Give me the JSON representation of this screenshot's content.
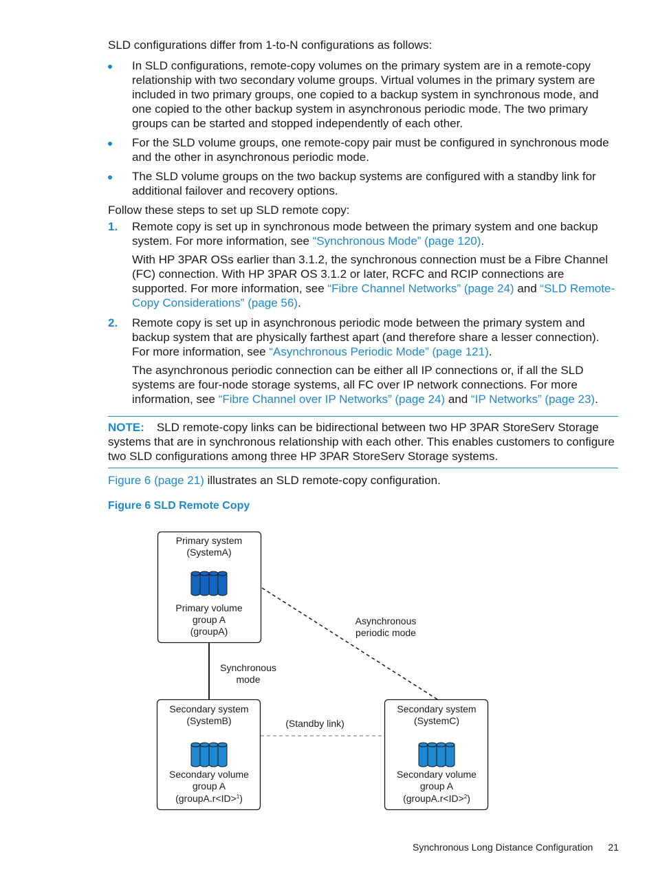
{
  "intro": "SLD configurations differ from 1-to-N configurations as follows:",
  "bullets": [
    "In SLD configurations, remote-copy volumes on the primary system are in a remote-copy relationship with two secondary volume groups. Virtual volumes in the primary system are included in two primary groups, one copied to a backup system in synchronous mode, and one copied to the other backup system in asynchronous periodic mode. The two primary groups can be started and stopped independently of each other.",
    "For the SLD volume groups, one remote-copy pair must be configured in synchronous mode and the other in asynchronous periodic mode.",
    "The SLD volume groups on the two backup systems are configured with a standby link for additional failover and recovery options."
  ],
  "steps_intro": "Follow these steps to set up SLD remote copy:",
  "steps": [
    {
      "number": "1.",
      "p1_text": "Remote copy is set up in synchronous mode between the primary system and one backup system. For more information, see ",
      "p1_link": "“Synchronous Mode” (page 120)",
      "p1_end": ".",
      "p2_text": "With HP 3PAR OSs earlier than 3.1.2, the synchronous connection must be a Fibre Channel (FC) connection. With HP 3PAR OS 3.1.2 or later, RCFC and RCIP connections are supported. For more information, see ",
      "p2_link1": "“Fibre Channel Networks” (page 24)",
      "p2_mid": " and ",
      "p2_link2": "“SLD Remote-Copy Considerations” (page 56)",
      "p2_end": "."
    },
    {
      "number": "2.",
      "p1_text": "Remote copy is set up in asynchronous periodic mode between the primary system and backup system that are physically farthest apart (and therefore share a lesser connection). For more information, see ",
      "p1_link": "“Asynchronous Periodic Mode” (page 121)",
      "p1_end": ".",
      "p2_text": "The asynchronous periodic connection can be either all IP connections or, if all the SLD systems are four-node storage systems, all FC over IP network connections. For more information, see ",
      "p2_link1": "“Fibre Channel over IP Networks” (page 24)",
      "p2_mid": " and ",
      "p2_link2": "“IP Networks” (page 23)",
      "p2_end": "."
    }
  ],
  "note": {
    "label": "NOTE:",
    "text": "SLD remote-copy links can be bidirectional between two HP 3PAR StoreServ Storage systems that are in synchronous relationship with each other. This enables customers to configure two SLD configurations among three HP 3PAR StoreServ Storage systems."
  },
  "figure_ref": {
    "link": "Figure 6 (page 21)",
    "text": " illustrates an SLD remote-copy configuration."
  },
  "figure_caption": "Figure 6 SLD Remote Copy",
  "diagram": {
    "primary": {
      "title1": "Primary system",
      "title2": "(SystemA)",
      "vol1": "Primary volume",
      "vol2": "group A",
      "vol3": "(groupA)"
    },
    "secondary_b": {
      "title1": "Secondary system",
      "title2": "(SystemB)",
      "vol1": "Secondary volume",
      "vol2": "group A",
      "vol3": "(groupA.r<ID>",
      "sup": "1",
      "vol3_end": ")"
    },
    "secondary_c": {
      "title1": "Secondary system",
      "title2": "(SystemC)",
      "vol1": "Secondary volume",
      "vol2": "group A",
      "vol3": "(groupA.r<ID>",
      "sup": "2",
      "vol3_end": ")"
    },
    "sync_label1": "Synchronous",
    "sync_label2": "mode",
    "async_label1": "Asynchronous",
    "async_label2": "periodic mode",
    "standby_label": "(Standby link)",
    "colors": {
      "primary_volume": "#1565c0",
      "secondary_volume": "#1e88d0",
      "accent": "#1e88d0"
    }
  },
  "footer": {
    "title": "Synchronous Long Distance Configuration",
    "page": "21"
  }
}
